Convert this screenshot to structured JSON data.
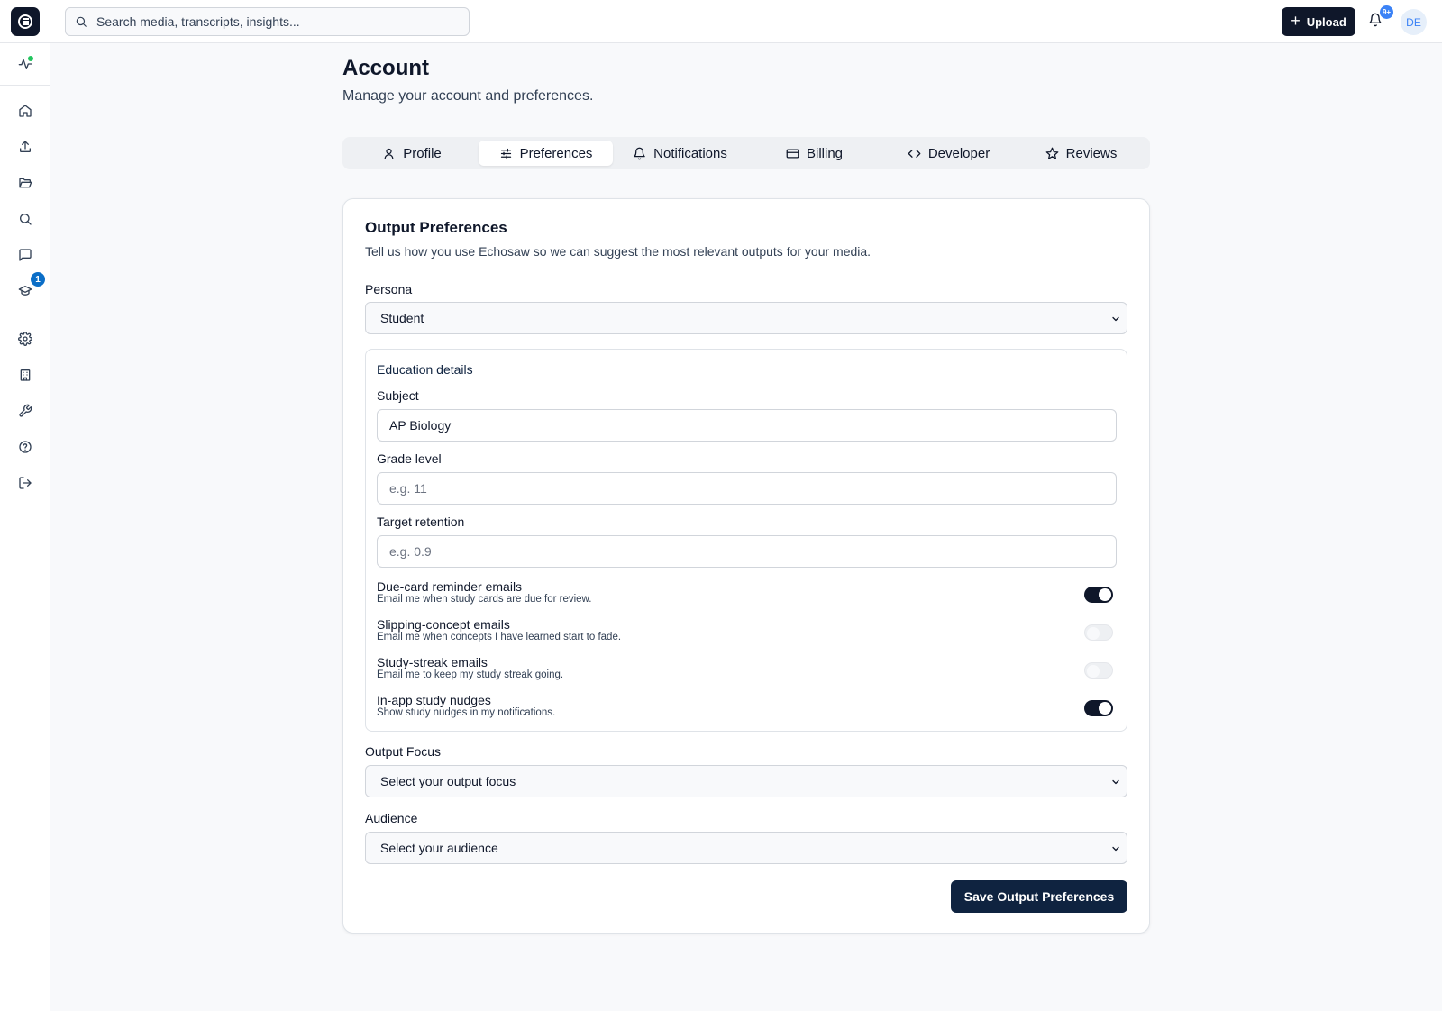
{
  "topbar": {
    "search_placeholder": "Search media, transcripts, insights...",
    "upload_label": "Upload",
    "notification_count": "9+",
    "avatar_initials": "DE"
  },
  "sidebar": {
    "items": [
      {
        "name": "activity",
        "icon": "activity-icon"
      },
      {
        "name": "home",
        "icon": "home-icon"
      },
      {
        "name": "upload",
        "icon": "upload-icon"
      },
      {
        "name": "library",
        "icon": "folder-open-icon"
      },
      {
        "name": "search",
        "icon": "search-icon"
      },
      {
        "name": "chat",
        "icon": "message-square-icon"
      },
      {
        "name": "study",
        "icon": "graduation-cap-icon",
        "badge": "1"
      },
      {
        "name": "settings",
        "icon": "gear-icon"
      },
      {
        "name": "organization",
        "icon": "building-icon"
      },
      {
        "name": "tools",
        "icon": "wrench-icon"
      },
      {
        "name": "help",
        "icon": "help-circle-icon"
      },
      {
        "name": "logout",
        "icon": "log-out-icon"
      }
    ]
  },
  "page": {
    "title": "Account",
    "subtitle": "Manage your account and preferences."
  },
  "tabs": [
    {
      "label": "Profile",
      "icon": "user-icon",
      "active": false
    },
    {
      "label": "Preferences",
      "icon": "sliders-icon",
      "active": true
    },
    {
      "label": "Notifications",
      "icon": "bell-icon",
      "active": false
    },
    {
      "label": "Billing",
      "icon": "credit-card-icon",
      "active": false
    },
    {
      "label": "Developer",
      "icon": "code-icon",
      "active": false
    },
    {
      "label": "Reviews",
      "icon": "star-icon",
      "active": false
    }
  ],
  "card": {
    "title": "Output Preferences",
    "description": "Tell us how you use Echosaw so we can suggest the most relevant outputs for your media.",
    "persona": {
      "label": "Persona",
      "value": "Student"
    },
    "education": {
      "heading": "Education details",
      "subject": {
        "label": "Subject",
        "value": "AP Biology"
      },
      "grade": {
        "label": "Grade level",
        "placeholder": "e.g. 11"
      },
      "retention": {
        "label": "Target retention",
        "placeholder": "e.g. 0.9"
      },
      "toggles": [
        {
          "title": "Due-card reminder emails",
          "desc": "Email me when study cards are due for review.",
          "on": true
        },
        {
          "title": "Slipping-concept emails",
          "desc": "Email me when concepts I have learned start to fade.",
          "on": false
        },
        {
          "title": "Study-streak emails",
          "desc": "Email me to keep my study streak going.",
          "on": false
        },
        {
          "title": "In-app study nudges",
          "desc": "Show study nudges in my notifications.",
          "on": true
        }
      ]
    },
    "output_focus": {
      "label": "Output Focus",
      "value": "Select your output focus"
    },
    "audience": {
      "label": "Audience",
      "value": "Select your audience"
    },
    "save_label": "Save Output Preferences"
  },
  "colors": {
    "primary": "#0f172a",
    "accent_blue": "#3b82f6",
    "badge_blue": "#0b6ec7",
    "status_green": "#22c55e"
  }
}
